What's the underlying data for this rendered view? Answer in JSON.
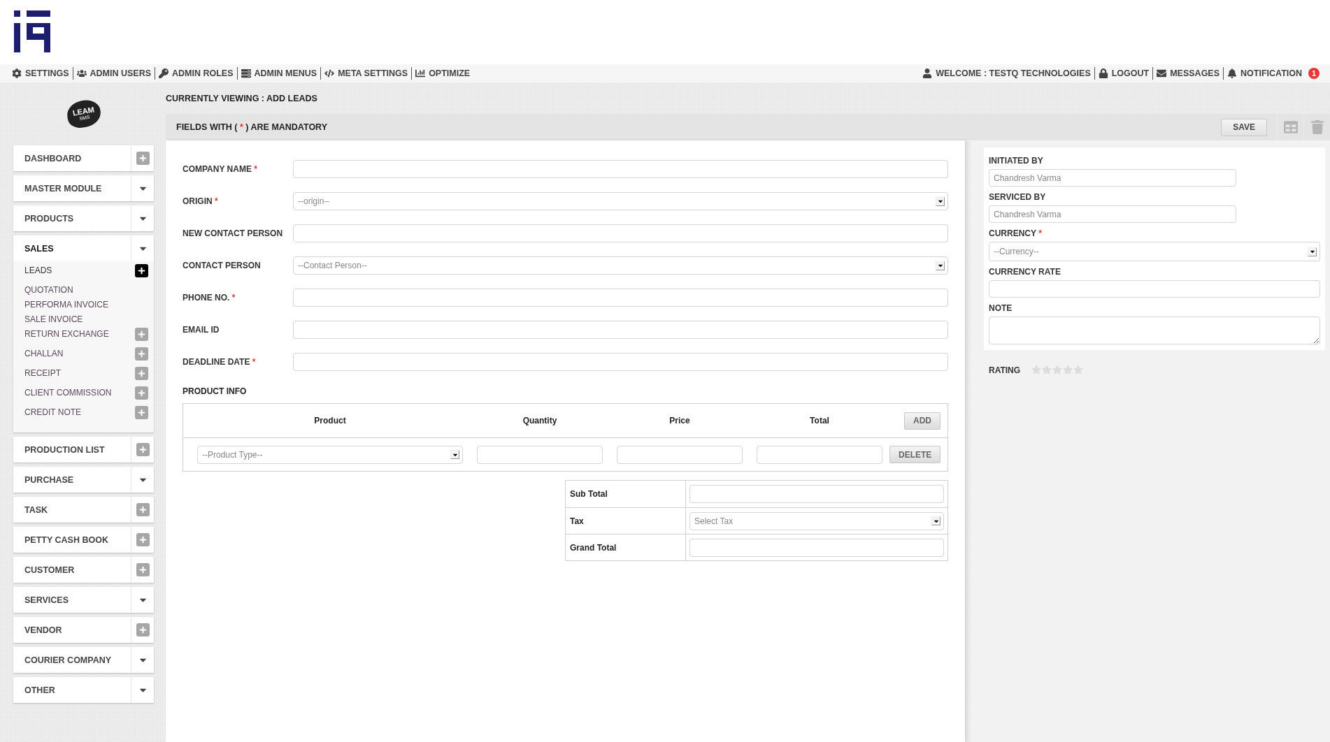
{
  "nav": {
    "left": [
      {
        "label": "SETTINGS"
      },
      {
        "label": "ADMIN USERS"
      },
      {
        "label": "ADMIN ROLES"
      },
      {
        "label": "ADMIN MENUS"
      },
      {
        "label": "META SETTINGS"
      },
      {
        "label": "OPTIMIZE"
      }
    ],
    "right": [
      {
        "label": "WELCOME : TESTQ TECHNOLOGIES"
      },
      {
        "label": "LOGOUT"
      },
      {
        "label": "MESSAGES"
      },
      {
        "label": "NOTIFICATION",
        "badge": "1"
      }
    ]
  },
  "sidebar": {
    "brand": {
      "title": "LEAM",
      "subtitle": "SMS"
    },
    "items": [
      {
        "label": "DASHBOARD",
        "kind": "add",
        "expanded": false
      },
      {
        "label": "MASTER MODULE",
        "kind": "menu",
        "expanded": false
      },
      {
        "label": "PRODUCTS",
        "kind": "menu",
        "expanded": false
      },
      {
        "label": "SALES",
        "kind": "menu",
        "expanded": true,
        "children": [
          {
            "label": "LEADS",
            "kind": "add",
            "selected": true
          },
          {
            "label": "QUOTATION",
            "kind": "plain",
            "selected": false
          },
          {
            "label": "PERFORMA INVOICE",
            "kind": "plain",
            "selected": false
          },
          {
            "label": "SALE INVOICE",
            "kind": "plain",
            "selected": false
          },
          {
            "label": "RETURN EXCHANGE",
            "kind": "add",
            "selected": false
          },
          {
            "label": "CHALLAN",
            "kind": "add",
            "selected": false
          },
          {
            "label": "RECEIPT",
            "kind": "add",
            "selected": false
          },
          {
            "label": "CLIENT COMMISSION",
            "kind": "add",
            "selected": false
          },
          {
            "label": "CREDIT NOTE",
            "kind": "add",
            "selected": false
          }
        ]
      },
      {
        "label": "PRODUCTION LIST",
        "kind": "add",
        "expanded": false
      },
      {
        "label": "PURCHASE",
        "kind": "menu",
        "expanded": false
      },
      {
        "label": "TASK",
        "kind": "add",
        "expanded": false
      },
      {
        "label": "PETTY CASH BOOK",
        "kind": "add",
        "expanded": false
      },
      {
        "label": "CUSTOMER",
        "kind": "add",
        "expanded": false
      },
      {
        "label": "SERVICES",
        "kind": "menu",
        "expanded": false
      },
      {
        "label": "VENDOR",
        "kind": "add",
        "expanded": false
      },
      {
        "label": "COURIER COMPANY",
        "kind": "menu",
        "expanded": false
      },
      {
        "label": "OTHER",
        "kind": "menu",
        "expanded": false
      }
    ]
  },
  "page": {
    "breadcrumb": "CURRENTLY VIEWING : ADD LEADS",
    "notice": {
      "before": "FIELDS WITH (",
      "mark": "*",
      "after": ") ARE MANDATORY"
    },
    "save": "SAVE"
  },
  "form": {
    "fields": [
      {
        "label": "COMPANY NAME",
        "mark": "*",
        "kind": "text"
      },
      {
        "label": "ORIGIN",
        "mark": "*",
        "kind": "select",
        "placeholder": "--origin--"
      },
      {
        "label": "NEW CONTACT PERSON",
        "kind": "text"
      },
      {
        "label": "CONTACT PERSON",
        "kind": "select",
        "placeholder": "--Contact Person--"
      },
      {
        "label": "PHONE NO.",
        "mark": "*",
        "kind": "text"
      },
      {
        "label": "EMAIL ID",
        "kind": "text"
      },
      {
        "label": "DEADLINE DATE",
        "mark": "*",
        "kind": "text"
      }
    ]
  },
  "product_info": {
    "title": "PRODUCT INFO",
    "columns": [
      "Product",
      "Quantity",
      "Price",
      "Total"
    ],
    "add": "ADD",
    "rows": [
      {
        "product_placeholder": "--Product Type--",
        "delete": "DELETE"
      }
    ]
  },
  "totals": [
    {
      "label": "Sub Total",
      "kind": "text"
    },
    {
      "label": "Tax",
      "kind": "select",
      "placeholder": "Select Tax"
    },
    {
      "label": "Grand Total",
      "kind": "text"
    }
  ],
  "side_panel": {
    "fields": [
      {
        "label": "INITIATED BY",
        "kind": "readonly",
        "value": "Chandresh Varma"
      },
      {
        "label": "SERVICED BY",
        "kind": "readonly",
        "value": "Chandresh Varma"
      },
      {
        "label": "CURRENCY",
        "mark": "*",
        "kind": "select",
        "placeholder": "--Currency--"
      },
      {
        "label": "CURRENCY RATE",
        "kind": "text"
      },
      {
        "label": "NOTE",
        "kind": "textarea"
      }
    ],
    "rating": {
      "label": "RATING",
      "stars": 0
    }
  }
}
